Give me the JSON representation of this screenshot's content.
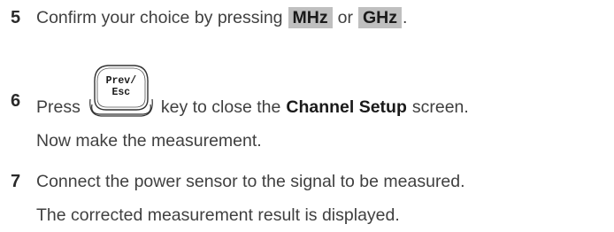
{
  "steps": [
    {
      "number": "5",
      "before": "Confirm your choice by pressing",
      "softkey_1": "MHz",
      "middle": "or",
      "softkey_2": "GHz",
      "after": "."
    },
    {
      "number": "6",
      "before": "Press",
      "key_line_1": "Prev/",
      "key_line_2": "Esc",
      "after": "key to close the",
      "bold": "Channel Setup",
      "end": "screen.",
      "note": "Now make the measurement."
    },
    {
      "number": "7",
      "text": "Connect the power sensor to the signal to be measured.",
      "note": "The corrected measurement result is displayed."
    }
  ]
}
